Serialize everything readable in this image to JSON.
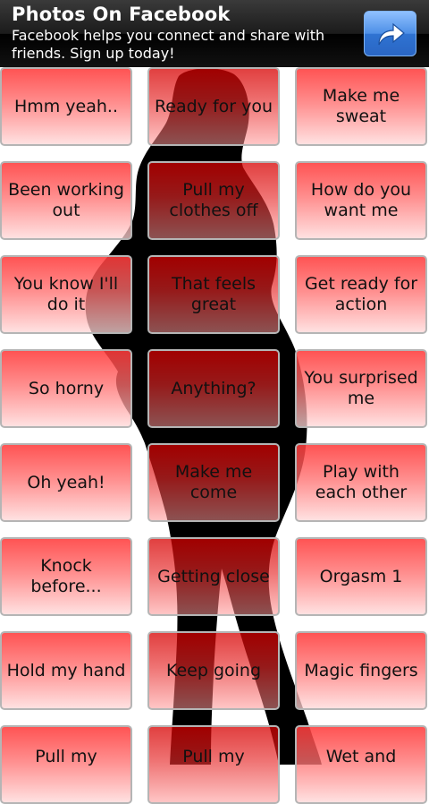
{
  "ad": {
    "title": "Photos On Facebook",
    "description": "Facebook helps you connect and share with friends. Sign up today!",
    "action_icon": "share-arrow-icon"
  },
  "buttons": [
    "Hmm yeah..",
    "Ready for you",
    "Make me sweat",
    "Been working out",
    "Pull my clothes off",
    "How do you want me",
    "You know I'll do it",
    "That feels great",
    "Get ready for action",
    "So horny",
    "Anything?",
    "You surprised me",
    "Oh yeah!",
    "Make me come",
    "Play with each other",
    "Knock before...",
    "Getting close",
    "Orgasm 1",
    "Hold my hand",
    "Keep going",
    "Magic fingers",
    "Pull my",
    "Pull my",
    "Wet and"
  ],
  "colors": {
    "accent_red": "#ff3c3c",
    "ad_button_blue": "#4d8fe6",
    "silhouette": "#000000"
  }
}
